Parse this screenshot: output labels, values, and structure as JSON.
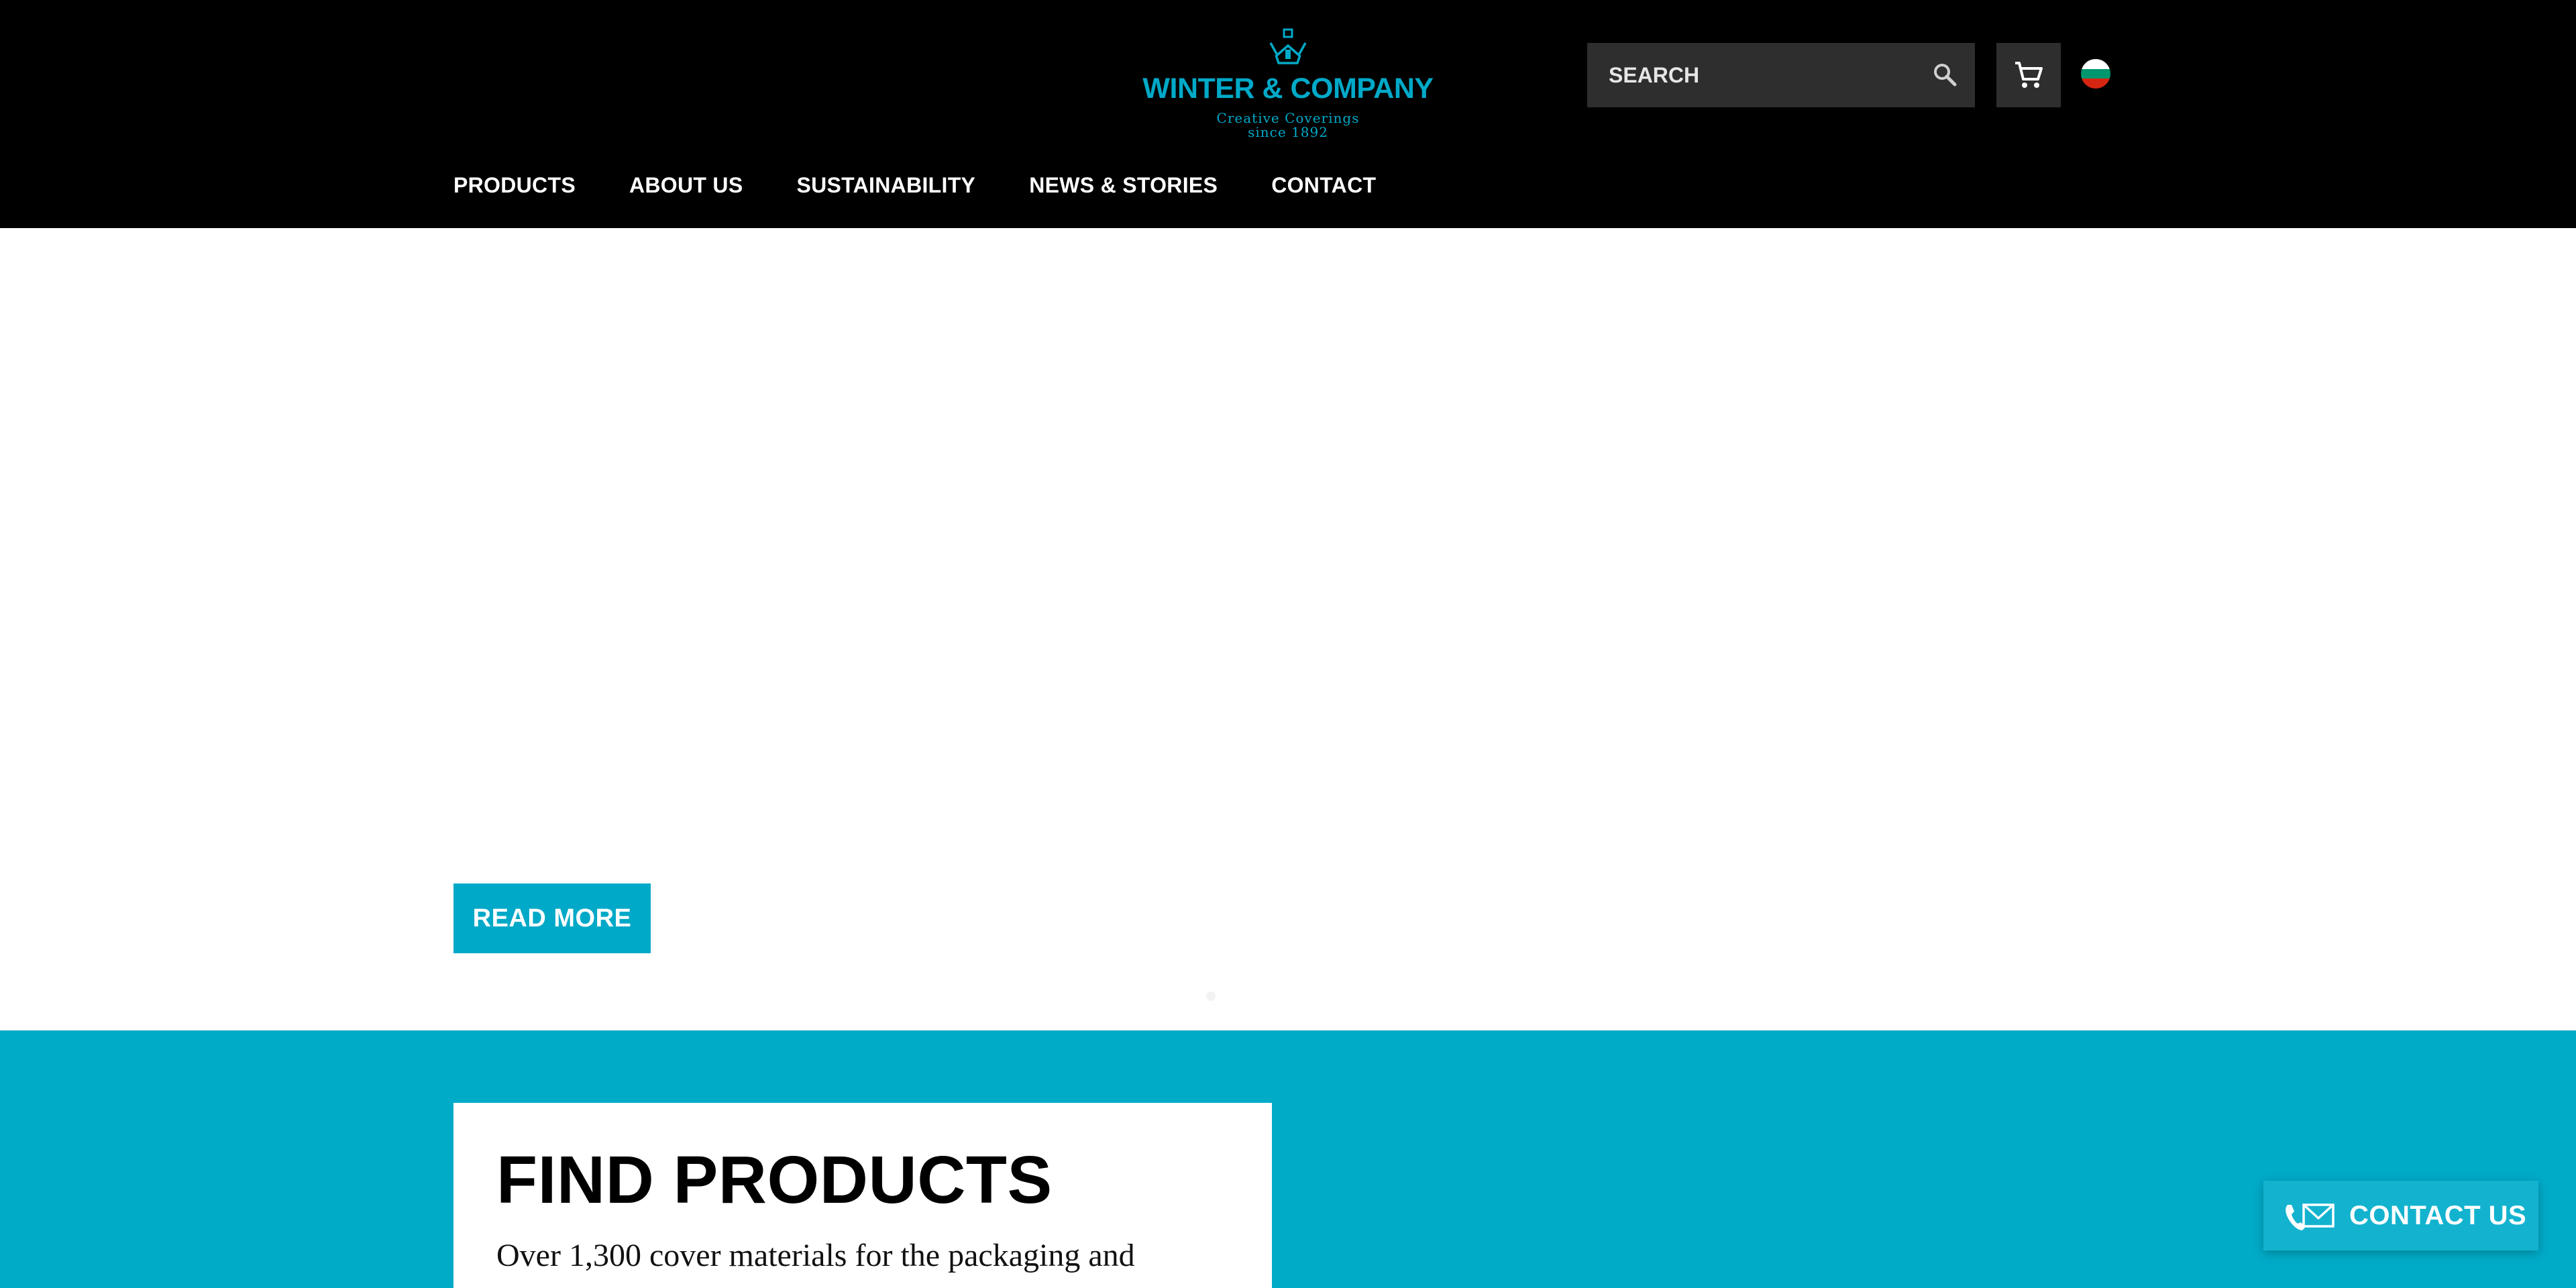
{
  "brand": {
    "name": "WINTER & COMPANY",
    "tagline_line1": "Creative Coverings",
    "tagline_line2": "since 1892",
    "color": "#00a9c8"
  },
  "header": {
    "search_placeholder": "SEARCH",
    "search_icon": "search-icon",
    "cart_icon": "cart-icon",
    "language_icon": "bulgarian-flag-icon"
  },
  "nav": {
    "items": [
      {
        "label": "PRODUCTS"
      },
      {
        "label": "ABOUT US"
      },
      {
        "label": "SUSTAINABILITY"
      },
      {
        "label": "NEWS & STORIES"
      },
      {
        "label": "CONTACT"
      }
    ]
  },
  "hero": {
    "read_more_label": "READ MORE"
  },
  "find_products": {
    "title": "FIND PRODUCTS",
    "text": "Over 1,300 cover materials for the packaging and"
  },
  "contact_widget": {
    "label": "CONTACT US",
    "icon": "phone-mail-icon"
  },
  "colors": {
    "header_bg": "#000000",
    "accent": "#00a9c8",
    "teal_section": "#00abc8",
    "search_bg": "#2e2e2e"
  }
}
